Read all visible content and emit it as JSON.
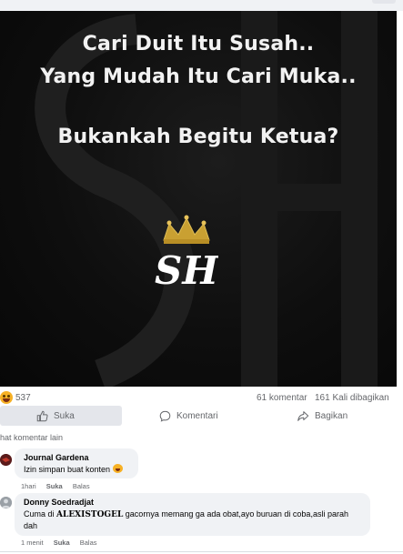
{
  "post": {
    "image_lines": [
      "Cari Duit Itu Susah..",
      "Yang Mudah Itu Cari Muka..",
      "Bukankah Begitu Ketua?"
    ],
    "logo_letters": "SH"
  },
  "stats": {
    "reaction_count": "537",
    "comments": "61 komentar",
    "shares": "161 Kali dibagikan"
  },
  "actions": {
    "like": "Suka",
    "comment": "Komentari",
    "share": "Bagikan"
  },
  "more_comments": "hat komentar lain",
  "comments": [
    {
      "author": "Journal Gardena",
      "text": "Izin simpan buat konten",
      "time": "1hari",
      "like": "Suka",
      "reply": "Balas"
    },
    {
      "author": "Donny Soedradjat",
      "text_prefix": "Cuma di ",
      "text_brand": "ALEXISTOGEL",
      "text_suffix": " gacornya memang ga ada obat,ayo buruan di coba,asli parah dah",
      "time": "1 menit",
      "like": "Suka",
      "reply": "Balas"
    }
  ]
}
